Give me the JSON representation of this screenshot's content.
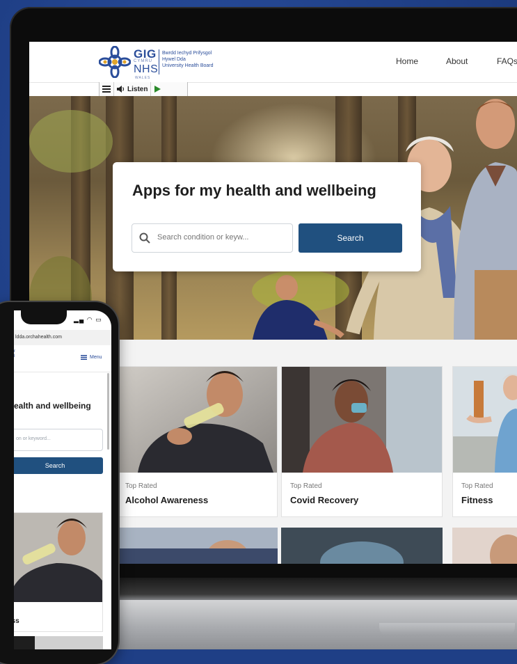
{
  "site": {
    "logo": {
      "gig": "GIG",
      "cymru": "CYMRU",
      "nhs": "NHS",
      "wales": "WALES",
      "board_line1": "Bwrdd Iechyd Prifysgol",
      "board_line2": "Hywel Dda",
      "board_line3": "University Health Board"
    },
    "nav": {
      "home": "Home",
      "about": "About",
      "faqs": "FAQs"
    },
    "toolbar": {
      "listen_label": "Listen"
    },
    "hero": {
      "title": "Apps for my health and wellbeing",
      "search_placeholder": "Search condition or keyw...",
      "search_button": "Search"
    },
    "cards": [
      {
        "tag": "Top Rated",
        "title": "Alcohol Awareness"
      },
      {
        "tag": "Top Rated",
        "title": "Covid Recovery"
      },
      {
        "tag": "Top Rated",
        "title": "Fitness"
      }
    ]
  },
  "phone": {
    "url": "ldda.orchahealth.com",
    "menu_label": "Menu",
    "title": "ealth and wellbeing",
    "search_placeholder": "on or keyword...",
    "search_button": "Search",
    "card_title": "ess"
  },
  "colors": {
    "background": "#1f3f86",
    "brand_blue": "#2a4d9a",
    "button_blue": "#20507f"
  }
}
